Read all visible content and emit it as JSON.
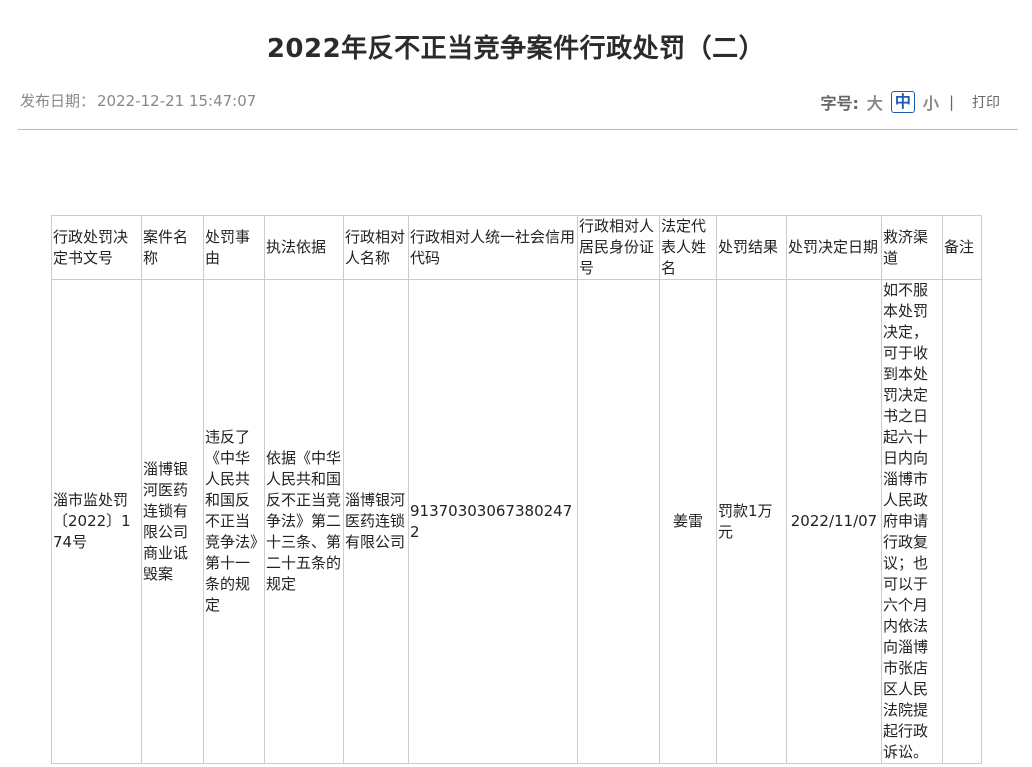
{
  "page": {
    "title": "2022年反不正当竞争案件行政处罚（二）",
    "publish_label": "发布日期：",
    "publish_date": "2022-12-21 15:47:07",
    "font_size_label": "字号:",
    "font_sizes": [
      "大",
      "中",
      "小"
    ],
    "separator": "|",
    "print_label": "打印"
  },
  "table": {
    "headers": [
      "行政处罚决定书文号",
      "案件名称",
      "处罚事由",
      "执法依据",
      "行政相对人名称",
      "行政相对人统一社会信用代码",
      "行政相对人居民身份证号",
      "法定代表人姓名",
      "处罚结果",
      "处罚决定日期",
      "救济渠道",
      "备注"
    ],
    "rows": [
      [
        "淄市监处罚〔2022〕174号",
        "淄博银河医药连锁有限公司商业诋毁案",
        "违反了《中华人民共和国反不正当竞争法》第十一条的规定",
        "依据《中华人民共和国反不正当竞争法》第二十三条、第二十五条的规定",
        "淄博银河医药连锁有限公司",
        "913703030673802472",
        "",
        "姜雷",
        "罚款1万元",
        "2022/11/07",
        "如不服本处罚决定，可于收到本处罚决定书之日起六十日内向淄博市人民政府申请行政复议；也可以于六个月内依法向淄博市张店区人民法院提起行政诉讼。",
        ""
      ]
    ]
  }
}
